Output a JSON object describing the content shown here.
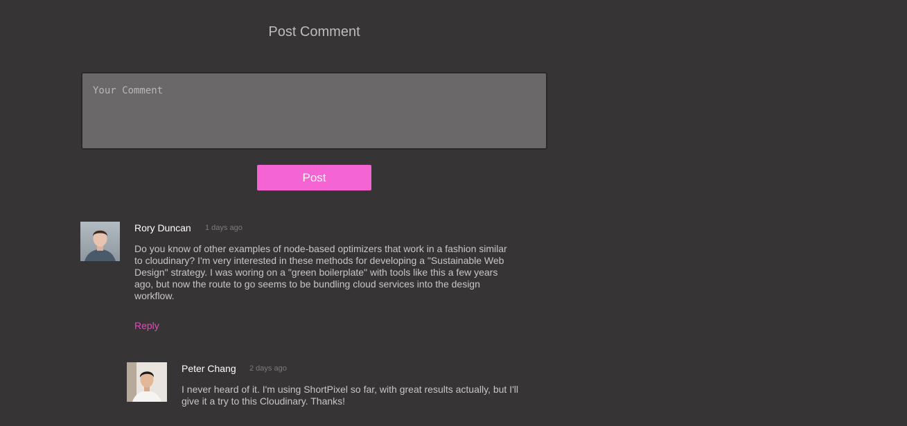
{
  "post_form": {
    "title": "Post Comment",
    "placeholder": "Your Comment",
    "value": "",
    "submit_label": "Post"
  },
  "comments": [
    {
      "author": "Rory Duncan",
      "date": "1 days ago",
      "text": "Do you know of other examples of node-based optimizers that work in a fashion similar to cloudinary? I'm very interested in these methods for developing a \"Sustainable Web Design\" strategy. I was woring on a \"green boilerplate\" with tools like this a few years ago, but now the route to go seems to be bundling cloud services into the design workflow.",
      "reply_label": "Reply"
    },
    {
      "author": "Peter Chang",
      "date": "2 days ago",
      "text": "I never heard of it. I'm using ShortPixel so far, with great results actually, but I'll give it a try to this Cloudinary. Thanks!"
    }
  ],
  "colors": {
    "background": "#373435",
    "accent": "#f464d2",
    "link": "#e24bbd"
  }
}
